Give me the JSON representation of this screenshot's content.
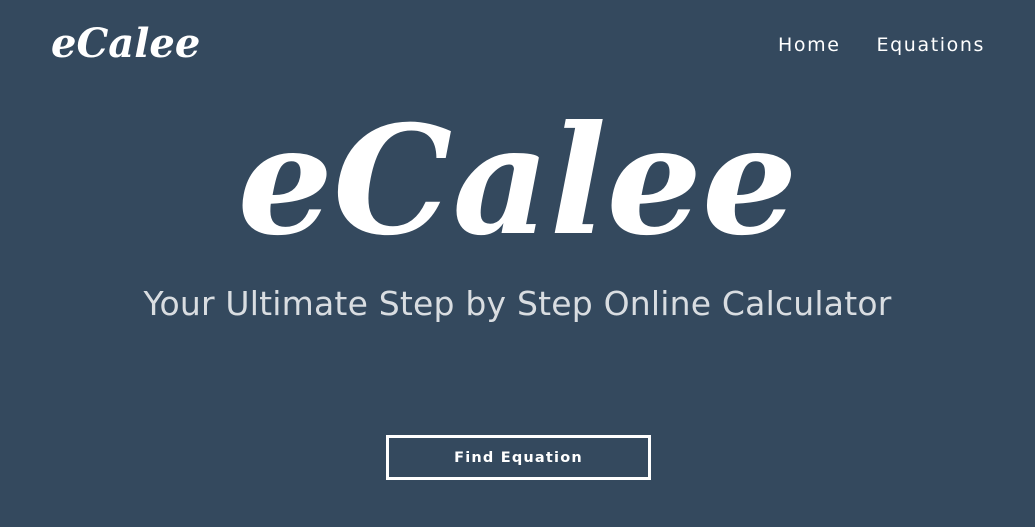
{
  "navbar": {
    "brand": "eCalee",
    "links": [
      {
        "label": "Home"
      },
      {
        "label": "Equations"
      }
    ]
  },
  "hero": {
    "logo_text": "eCalee",
    "tagline": "Your Ultimate Step by Step Online Calculator",
    "cta_label": "Find Equation"
  },
  "colors": {
    "background": "#34495e",
    "text": "#ffffff",
    "tagline": "#d9dde1"
  }
}
